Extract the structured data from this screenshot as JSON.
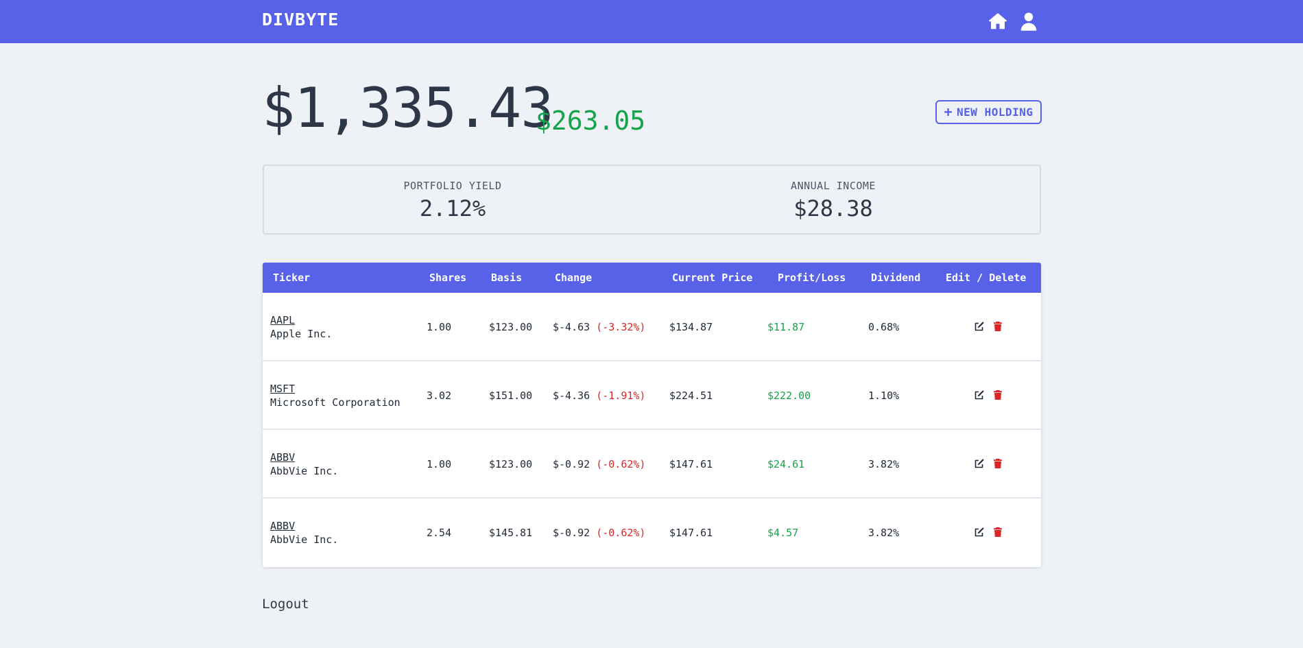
{
  "header": {
    "brand": "DIVBYTE",
    "icons": [
      "home-icon",
      "user-icon"
    ],
    "color": "#5762e8"
  },
  "summary": {
    "total_value": "$1,335.43",
    "gain": "$263.05",
    "new_holding_label": "NEW HOLDING"
  },
  "stats": {
    "yield_label": "PORTFOLIO YIELD",
    "yield_value": "2.12%",
    "income_label": "ANNUAL INCOME",
    "income_value": "$28.38"
  },
  "table": {
    "columns": [
      "Ticker",
      "Shares",
      "Basis",
      "Change",
      "Current Price",
      "Profit/Loss",
      "Dividend",
      "Edit / Delete"
    ],
    "rows": [
      {
        "ticker": "AAPL",
        "company": "Apple Inc.",
        "shares": "1.00",
        "basis": "$123.00",
        "change": "$-4.63",
        "change_pct": "(-3.32%)",
        "price": "$134.87",
        "profit_loss": "$11.87",
        "dividend": "0.68%"
      },
      {
        "ticker": "MSFT",
        "company": "Microsoft Corporation",
        "shares": "3.02",
        "basis": "$151.00",
        "change": "$-4.36",
        "change_pct": "(-1.91%)",
        "price": "$224.51",
        "profit_loss": "$222.00",
        "dividend": "1.10%"
      },
      {
        "ticker": "ABBV",
        "company": "AbbVie Inc.",
        "shares": "1.00",
        "basis": "$123.00",
        "change": "$-0.92",
        "change_pct": "(-0.62%)",
        "price": "$147.61",
        "profit_loss": "$24.61",
        "dividend": "3.82%"
      },
      {
        "ticker": "ABBV",
        "company": "AbbVie Inc.",
        "shares": "2.54",
        "basis": "$145.81",
        "change": "$-0.92",
        "change_pct": "(-0.62%)",
        "price": "$147.61",
        "profit_loss": "$4.57",
        "dividend": "3.82%"
      }
    ]
  },
  "footer": {
    "logout_label": "Logout"
  },
  "colors": {
    "accent": "#5762e8",
    "positive": "#16a34a",
    "negative": "#dc2626"
  }
}
